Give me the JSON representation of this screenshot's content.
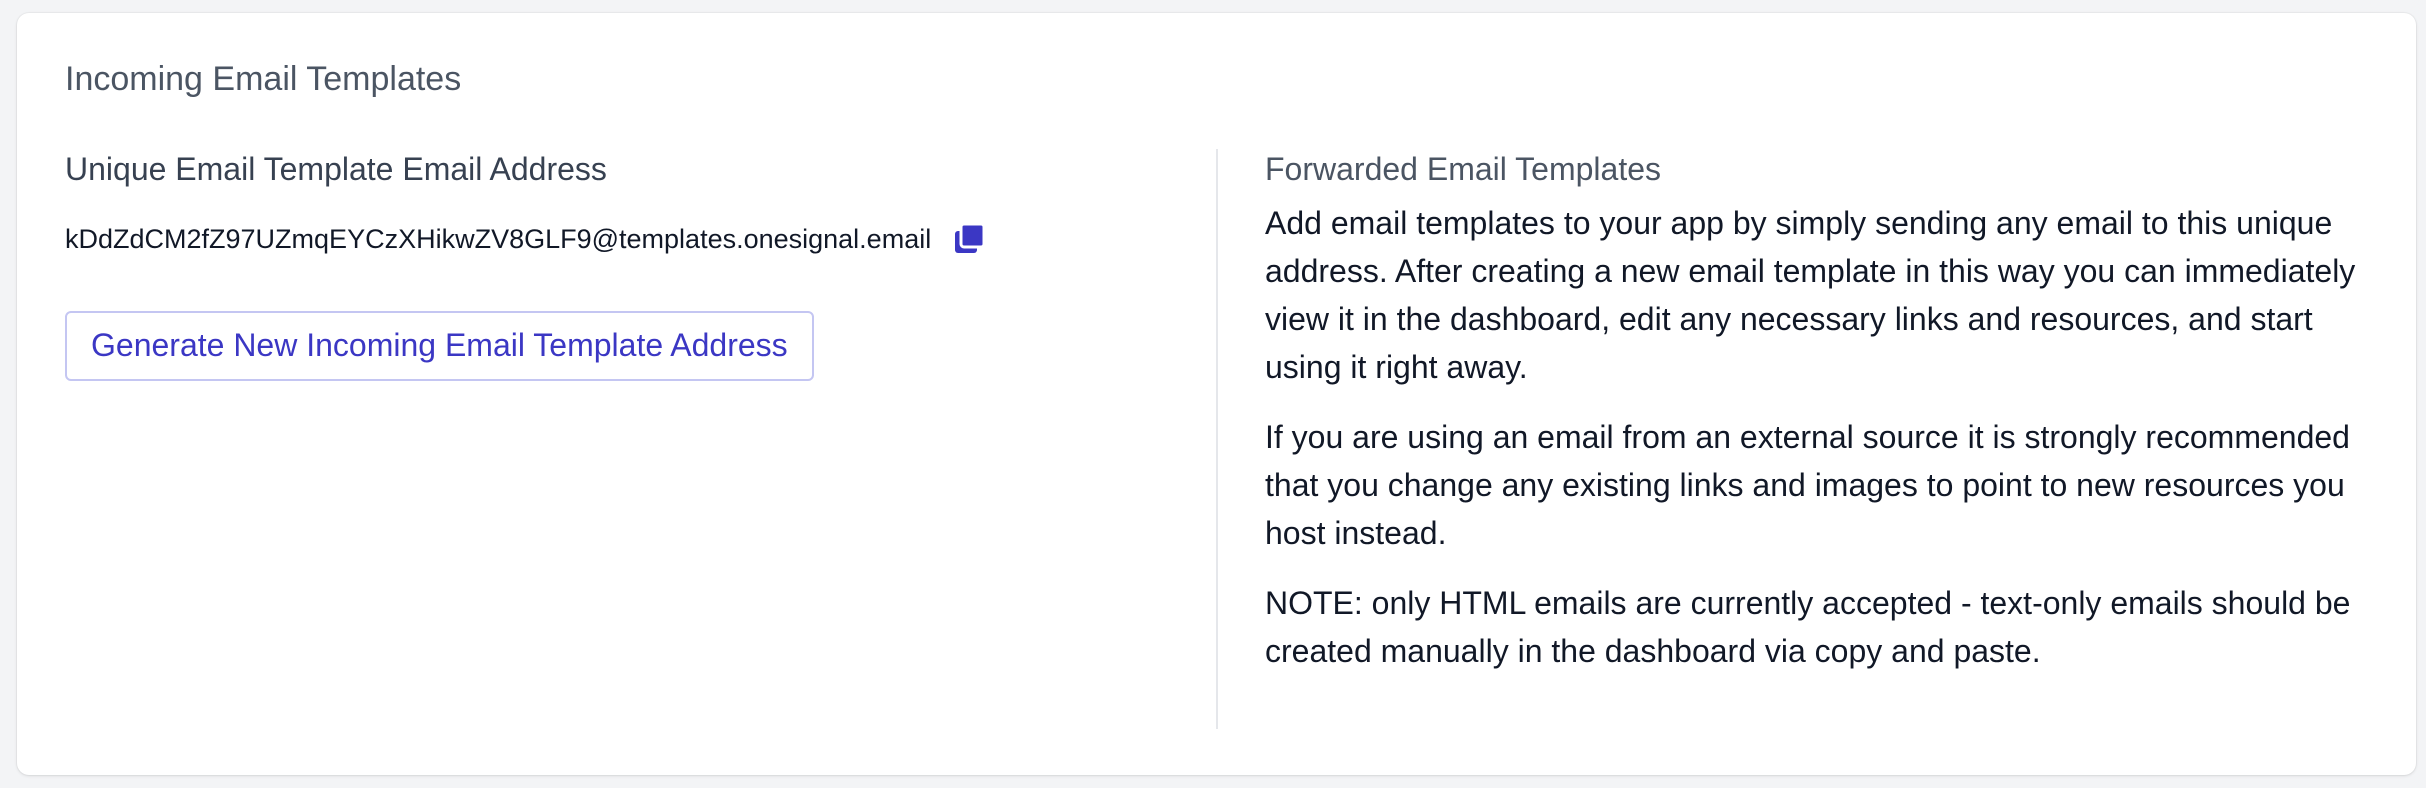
{
  "card": {
    "title": "Incoming Email Templates"
  },
  "left": {
    "label": "Unique Email Template Email Address",
    "address": "kDdZdCM2fZ97UZmqEYCzXHikwZV8GLF9@templates.onesignal.email",
    "copy_icon": "copy-icon",
    "generate_button_label": "Generate New Incoming Email Template Address"
  },
  "right": {
    "label": "Forwarded Email Templates",
    "paragraphs": [
      "Add email templates to your app by simply sending any email to this unique address. After creating a new email template in this way you can immediately view it in the dashboard, edit any necessary links and resources, and start using it right away.",
      "If you are using an email from an external source it is strongly recommended that you change any existing links and images to point to new resources you host instead.",
      "NOTE: only HTML emails are currently accepted - text-only emails should be created manually in the dashboard via copy and paste."
    ]
  },
  "colors": {
    "accent": "#3b37c4",
    "button_border": "#c4c6f2",
    "text": "#111827",
    "muted": "#4b5563",
    "background": "#f3f4f6"
  }
}
